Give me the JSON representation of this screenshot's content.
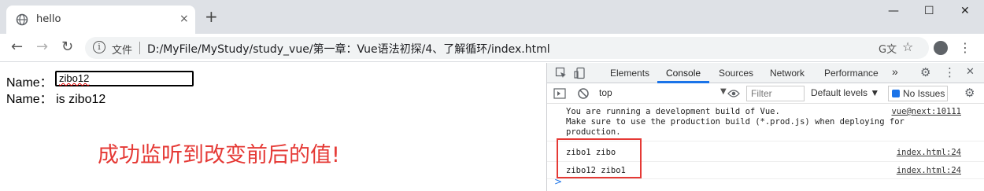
{
  "tab": {
    "title": "hello",
    "close": "×",
    "newtab": "+"
  },
  "window": {
    "minimize": "—",
    "maximize": "☐",
    "close": "✕"
  },
  "toolbar": {
    "back": "←",
    "forward": "→",
    "reload": "↻",
    "info_icon": "i",
    "scheme": "文件",
    "url": "D:/MyFile/MyStudy/study_vue/第一章：Vue语法初探/4、了解循环/index.html",
    "translate": "G文",
    "star": "☆",
    "menu": "⋮"
  },
  "page": {
    "row1_label": "Name：",
    "input_value": "zibo12",
    "row2_text": "Name：  is zibo12",
    "annotation": "成功监听到改变前后的值!"
  },
  "devtools": {
    "tabs": [
      "Elements",
      "Console",
      "Sources",
      "Network",
      "Performance"
    ],
    "more_tabs": "»",
    "settings_icon": "⚙",
    "kebab": "⋮",
    "close": "✕",
    "context": "top",
    "filter_placeholder": "Filter",
    "levels": "Default levels ▼",
    "issues": "No Issues",
    "messages": [
      {
        "text": "You are running a development build of Vue.\nMake sure to use the production build (*.prod.js) when deploying for\nproduction.",
        "source": "vue@next:10111"
      },
      {
        "text": "zibo1 zibo",
        "source": "index.html:24"
      },
      {
        "text": "zibo12 zibo1",
        "source": "index.html:24"
      }
    ],
    "prompt": ">"
  },
  "colors": {
    "annotation": "#e53935",
    "highlight_box": "#e53935",
    "link_blue": "#1a73e8"
  }
}
